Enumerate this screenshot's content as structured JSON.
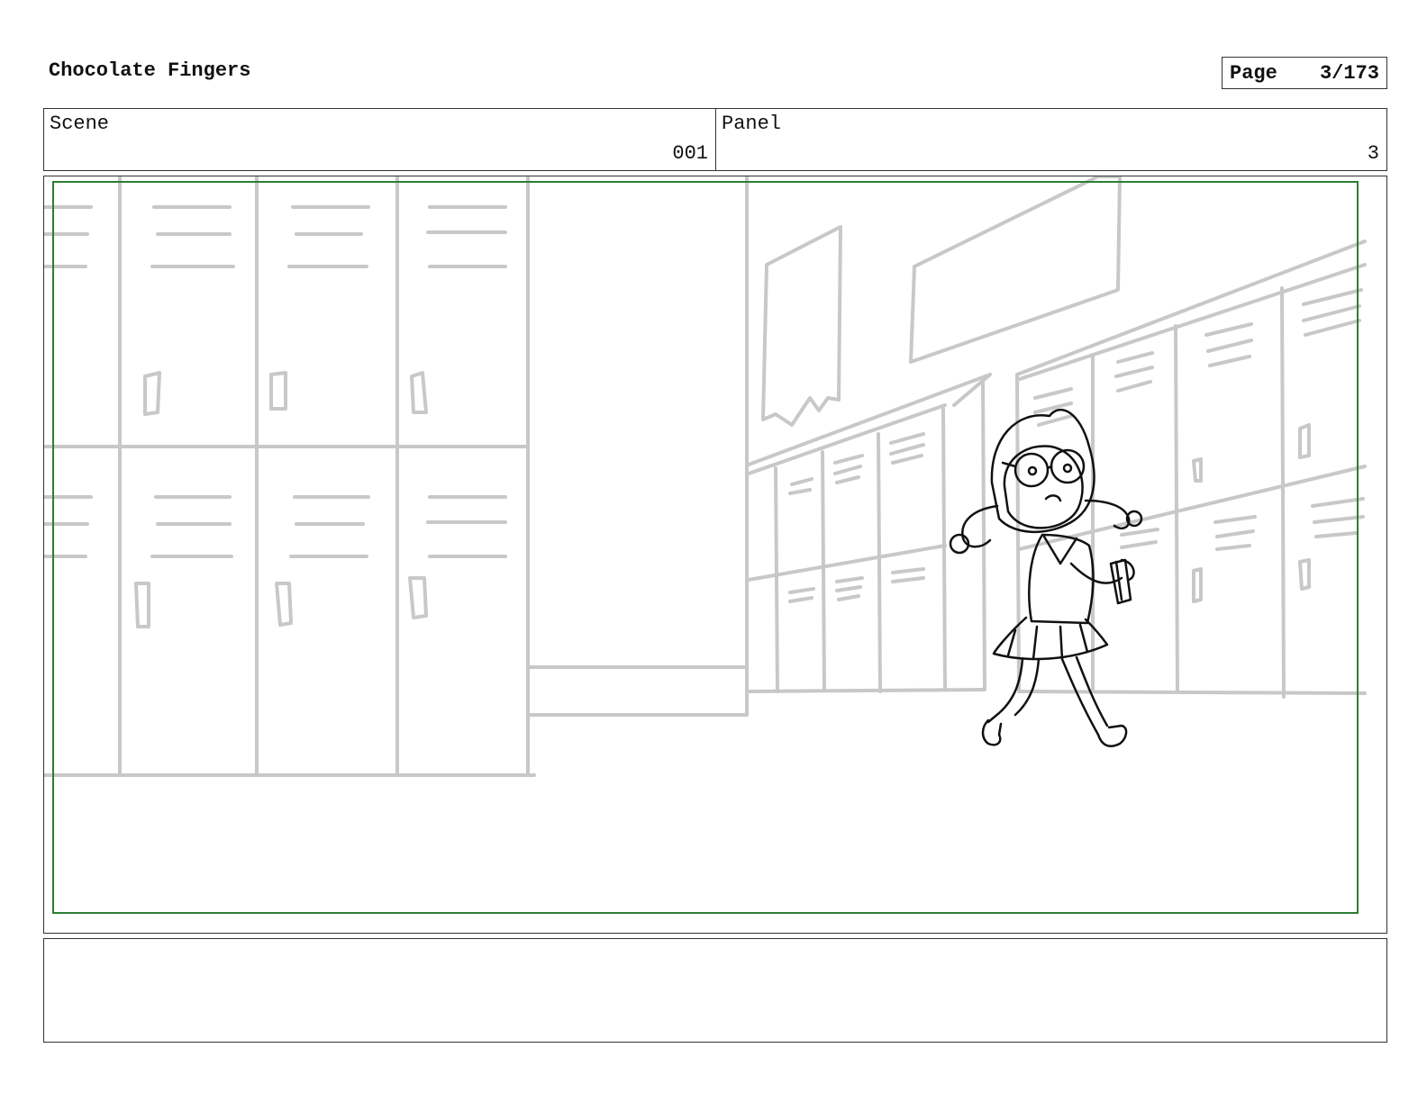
{
  "header": {
    "title": "Chocolate Fingers",
    "page_label": "Page",
    "page_number": "3/173"
  },
  "scene": {
    "label": "Scene",
    "value": "001"
  },
  "panel": {
    "label": "Panel",
    "value": "3"
  },
  "notes": {
    "text": ""
  },
  "colors": {
    "safe_frame": "#2e7d32",
    "background_sketch": "#c8c8c8",
    "character_line": "#111111"
  }
}
